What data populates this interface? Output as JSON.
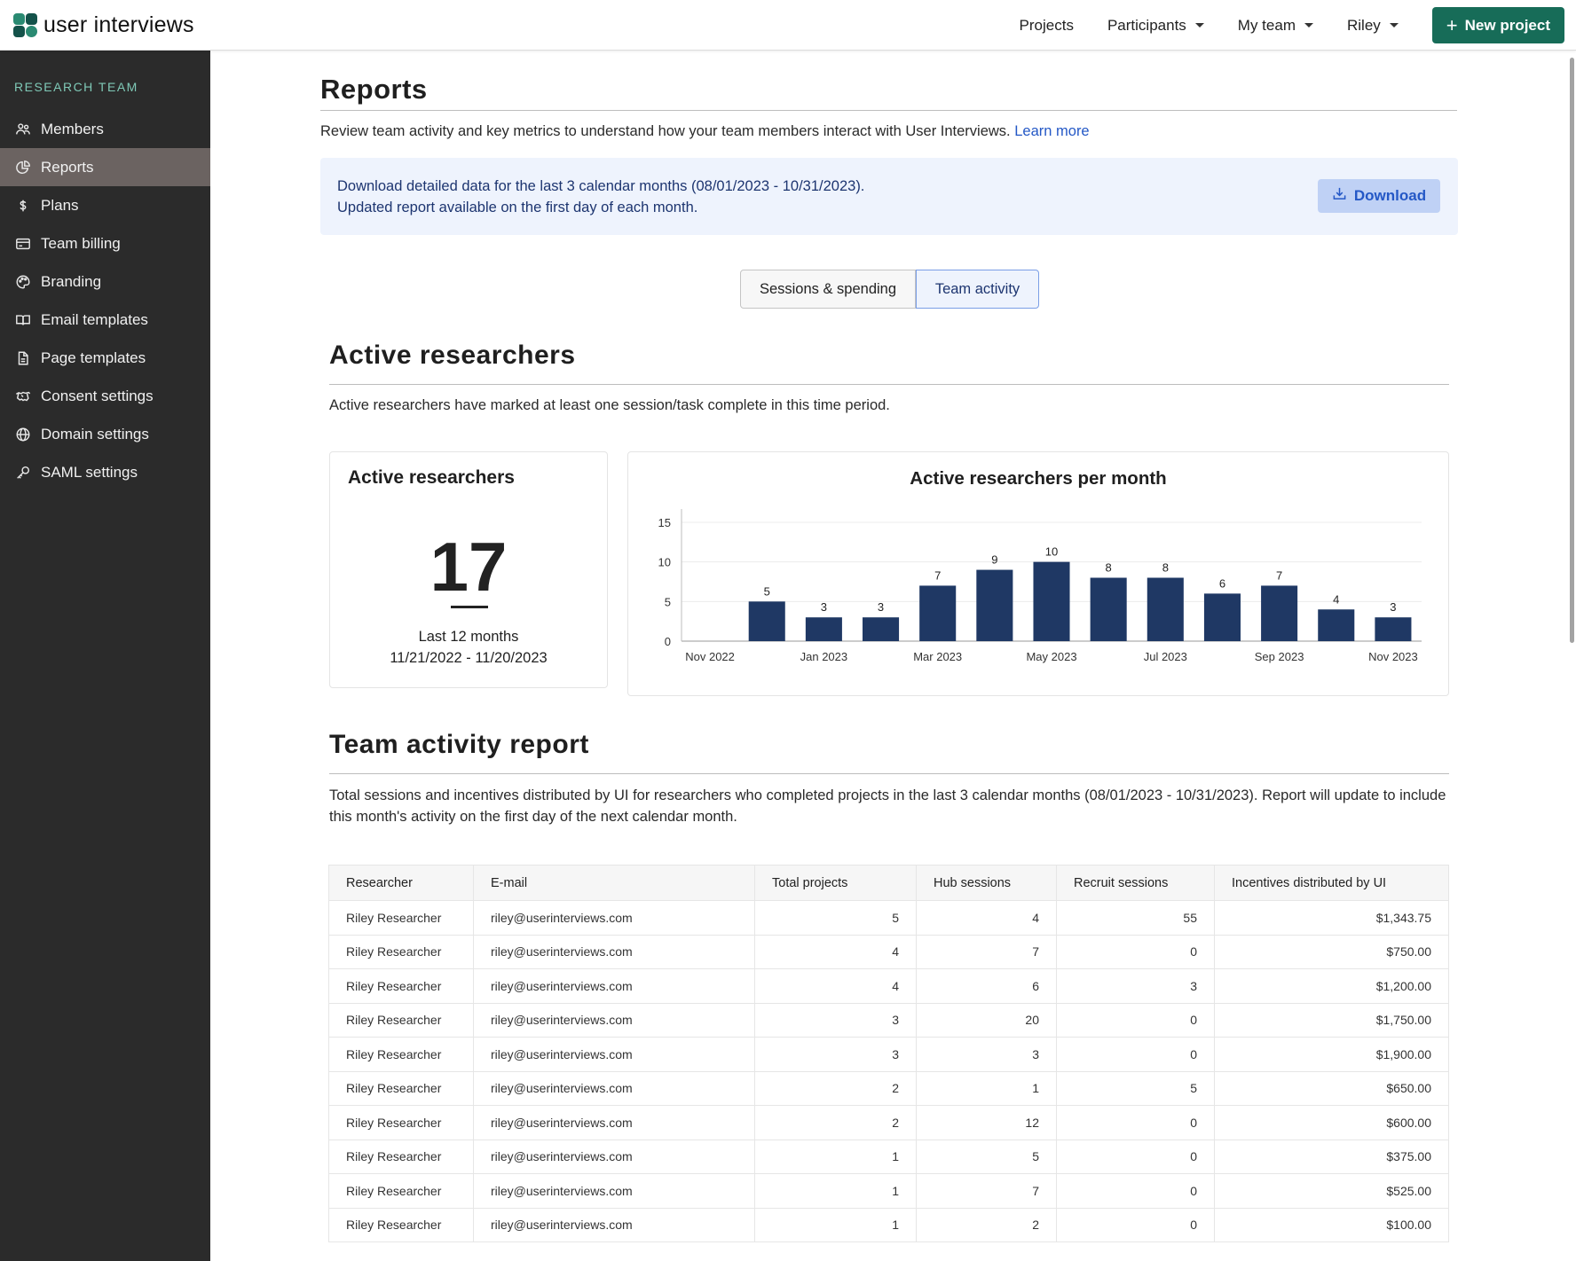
{
  "topbar": {
    "logo_text": "user interviews",
    "nav": [
      {
        "label": "Projects",
        "dropdown": false
      },
      {
        "label": "Participants",
        "dropdown": true
      },
      {
        "label": "My team",
        "dropdown": true
      },
      {
        "label": "Riley",
        "dropdown": true
      }
    ],
    "new_project_label": "New project",
    "brand_color": "#176c58"
  },
  "sidebar": {
    "title": "RESEARCH TEAM",
    "items": [
      {
        "label": "Members",
        "icon": "members-icon",
        "active": false
      },
      {
        "label": "Reports",
        "icon": "reports-icon",
        "active": true
      },
      {
        "label": "Plans",
        "icon": "dollar-icon",
        "active": false
      },
      {
        "label": "Team billing",
        "icon": "credit-card-icon",
        "active": false
      },
      {
        "label": "Branding",
        "icon": "palette-icon",
        "active": false
      },
      {
        "label": "Email templates",
        "icon": "book-icon",
        "active": false
      },
      {
        "label": "Page templates",
        "icon": "document-icon",
        "active": false
      },
      {
        "label": "Consent settings",
        "icon": "handshake-icon",
        "active": false
      },
      {
        "label": "Domain settings",
        "icon": "globe-icon",
        "active": false
      },
      {
        "label": "SAML settings",
        "icon": "key-icon",
        "active": false
      }
    ]
  },
  "page": {
    "title": "Reports",
    "intro": "Review team activity and key metrics to understand how your team members interact with User Interviews.",
    "learn_more": "Learn more",
    "banner_line1": "Download detailed data for the last 3 calendar months (08/01/2023 - 10/31/2023).",
    "banner_line2": "Updated report available on the first day of each month.",
    "download_label": "Download",
    "tabs": [
      "Sessions & spending",
      "Team activity"
    ],
    "active_tab": "Team activity"
  },
  "active_researchers": {
    "heading": "Active researchers",
    "description": "Active researchers have marked at least one session/task complete in this time period.",
    "card_title": "Active researchers",
    "count": "17",
    "period_label": "Last 12 months",
    "period_range": "11/21/2022 - 11/20/2023"
  },
  "chart_data": {
    "type": "bar",
    "title": "Active researchers per month",
    "categories": [
      "Nov 2022",
      "Dec 2022",
      "Jan 2023",
      "Feb 2023",
      "Mar 2023",
      "Apr 2023",
      "May 2023",
      "Jun 2023",
      "Jul 2023",
      "Aug 2023",
      "Sep 2023",
      "Oct 2023",
      "Nov 2023"
    ],
    "values": [
      0,
      5,
      3,
      3,
      7,
      9,
      10,
      8,
      8,
      6,
      7,
      4,
      3
    ],
    "data_labels": [
      "",
      "5",
      "3",
      "3",
      "7",
      "9",
      "10",
      "8",
      "8",
      "6",
      "7",
      "4",
      "3"
    ],
    "x_tick_labels": [
      "Nov 2022",
      "Jan 2023",
      "Mar 2023",
      "May 2023",
      "Jul 2023",
      "Sep 2023",
      "Nov 2023"
    ],
    "y_ticks": [
      0,
      5,
      10,
      15
    ],
    "ylim": [
      0,
      16
    ],
    "xlabel": "",
    "ylabel": "",
    "grid": true,
    "bar_color": "#1f3864"
  },
  "team_activity": {
    "heading": "Team activity report",
    "description": "Total sessions and incentives distributed by UI for researchers who completed projects in the last 3 calendar months (08/01/2023 - 10/31/2023). Report will update to include this month's activity on the first day of the next calendar month.",
    "columns": [
      "Researcher",
      "E-mail",
      "Total projects",
      "Hub sessions",
      "Recruit sessions",
      "Incentives distributed by UI"
    ],
    "rows": [
      [
        "Riley Researcher",
        "riley@userinterviews.com",
        "5",
        "4",
        "55",
        "$1,343.75"
      ],
      [
        "Riley Researcher",
        "riley@userinterviews.com",
        "4",
        "7",
        "0",
        "$750.00"
      ],
      [
        "Riley Researcher",
        "riley@userinterviews.com",
        "4",
        "6",
        "3",
        "$1,200.00"
      ],
      [
        "Riley Researcher",
        "riley@userinterviews.com",
        "3",
        "20",
        "0",
        "$1,750.00"
      ],
      [
        "Riley Researcher",
        "riley@userinterviews.com",
        "3",
        "3",
        "0",
        "$1,900.00"
      ],
      [
        "Riley Researcher",
        "riley@userinterviews.com",
        "2",
        "1",
        "5",
        "$650.00"
      ],
      [
        "Riley Researcher",
        "riley@userinterviews.com",
        "2",
        "12",
        "0",
        "$600.00"
      ],
      [
        "Riley Researcher",
        "riley@userinterviews.com",
        "1",
        "5",
        "0",
        "$375.00"
      ],
      [
        "Riley Researcher",
        "riley@userinterviews.com",
        "1",
        "7",
        "0",
        "$525.00"
      ],
      [
        "Riley Researcher",
        "riley@userinterviews.com",
        "1",
        "2",
        "0",
        "$100.00"
      ]
    ]
  }
}
